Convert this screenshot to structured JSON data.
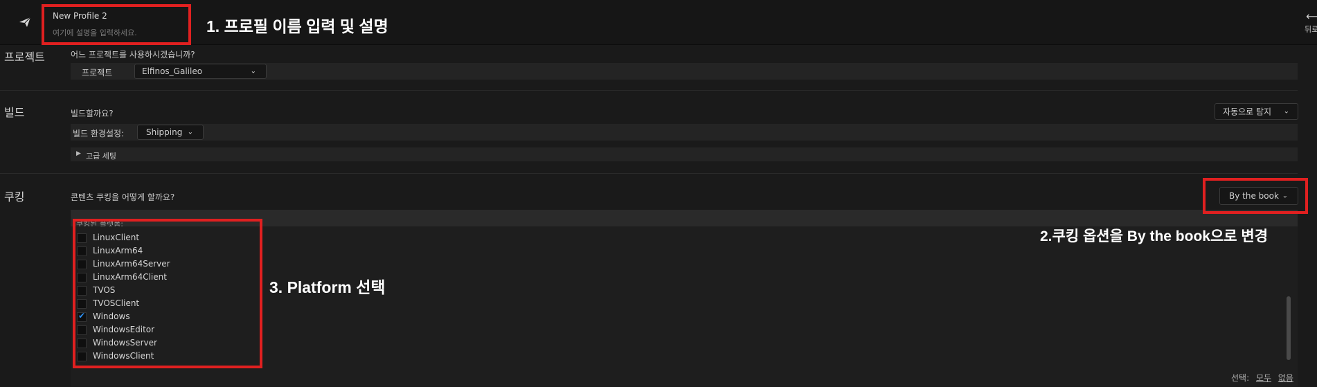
{
  "header": {
    "profile_name": "New Profile 2",
    "profile_description_placeholder": "여기에 설명을 입력하세요.",
    "back_label": "뒤로"
  },
  "project": {
    "title": "프로젝트",
    "question": "어느 프로젝트를 사용하시겠습니까?",
    "field_label": "프로젝트",
    "selected": "Elfinos_Galileo"
  },
  "build": {
    "title": "빌드",
    "question": "빌드할까요?",
    "auto_detect": "자동으로 탐지",
    "config_label": "빌드 환경설정:",
    "config_value": "Shipping",
    "advanced_label": "고급 세팅"
  },
  "cook": {
    "title": "쿠킹",
    "question": "콘텐츠 쿠킹을 어떻게 할까요?",
    "mode": "By the book",
    "platforms_header": "쿠킹된 플랫폼:",
    "platforms": [
      {
        "name": "LinuxClient",
        "checked": false
      },
      {
        "name": "LinuxArm64",
        "checked": false
      },
      {
        "name": "LinuxArm64Server",
        "checked": false
      },
      {
        "name": "LinuxArm64Client",
        "checked": false
      },
      {
        "name": "TVOS",
        "checked": false
      },
      {
        "name": "TVOSClient",
        "checked": false
      },
      {
        "name": "Windows",
        "checked": true
      },
      {
        "name": "WindowsEditor",
        "checked": false
      },
      {
        "name": "WindowsServer",
        "checked": false
      },
      {
        "name": "WindowsClient",
        "checked": false
      }
    ],
    "select_label": "선택:",
    "select_all": "모두",
    "select_none": "없음"
  },
  "annotations": {
    "step1": "1. 프로필 이름 입력 및 설명",
    "step2": "2.쿠킹 옵션을 By the book으로 변경",
    "step3": "3. Platform 선택"
  },
  "colors": {
    "annotation_red": "#e02020",
    "check_blue": "#2d8ff0"
  }
}
